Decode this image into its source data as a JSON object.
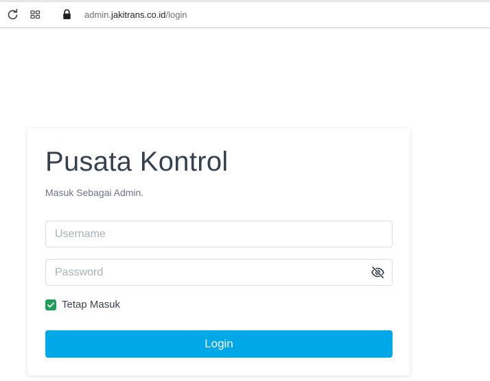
{
  "browser": {
    "url_prefix": "admin.",
    "url_host": "jakitrans.co.id",
    "url_path": "/login",
    "icons": [
      "reload-icon",
      "apps-icon",
      "lock-icon"
    ]
  },
  "login": {
    "title": "Pusata Kontrol",
    "subtitle": "Masuk Sebagai Admin.",
    "username_placeholder": "Username",
    "password_placeholder": "Password",
    "remember_label": "Tetap Masuk",
    "remember_checked": true,
    "submit_label": "Login",
    "toggle_icon": "eye-slash-icon"
  },
  "colors": {
    "accent": "#00a8e8",
    "checkbox": "#1e9e5a",
    "title": "#364150"
  }
}
